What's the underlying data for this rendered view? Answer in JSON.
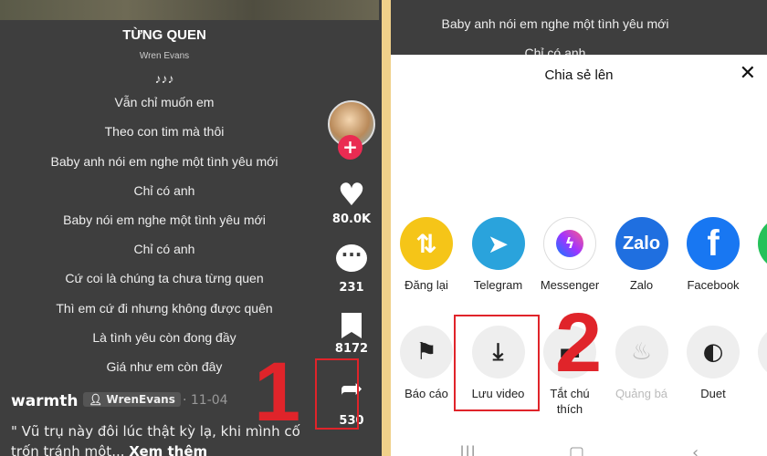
{
  "left": {
    "song_title": "TỪNG QUEN",
    "artist": "Wren Evans",
    "notes": "♪♪♪",
    "lyrics": [
      "Vẫn chỉ muốn em",
      "Theo con tim mà thôi",
      "Baby anh nói em nghe một tình yêu mới",
      "Chỉ có anh",
      "Baby nói em nghe một tình yêu mới",
      "Chỉ có anh",
      "Cứ coi là chúng ta chưa từng quen",
      "Thì em cứ đi nhưng không được quên",
      "Là tình yêu còn đong đầy",
      "Giá như em còn đây"
    ],
    "likes": "80.0K",
    "comments": "231",
    "saves": "8172",
    "shares": "530",
    "username": "warmth",
    "tag": "WrenEvans",
    "date": "· 11-04",
    "description": "\" Vũ trụ này đôi lúc thật kỳ lạ, khi mình cố trốn tránh một...",
    "see_more": "Xem thêm",
    "step": "1"
  },
  "right": {
    "bg_lyrics": [
      "Baby anh nói em nghe một tình yêu mới",
      "Chỉ có anh"
    ],
    "sheet_title": "Chia sẻ lên",
    "close": "✕",
    "share_row": [
      {
        "label": "Đăng lại",
        "icon": "repost-icon",
        "color": "#f5c518"
      },
      {
        "label": "Telegram",
        "icon": "telegram-icon",
        "color": "#2aa3dc"
      },
      {
        "label": "Messenger",
        "icon": "messenger-icon",
        "color": "#ffffff"
      },
      {
        "label": "Zalo",
        "icon": "zalo-icon",
        "color": "#1f6fe0",
        "text": "Zalo"
      },
      {
        "label": "Facebook",
        "icon": "facebook-icon",
        "color": "#1877f2",
        "text": "f"
      }
    ],
    "action_row": [
      {
        "label": "Báo cáo",
        "icon": "flag-icon"
      },
      {
        "label": "Lưu video",
        "icon": "download-icon"
      },
      {
        "label": "Tắt chú thích",
        "icon": "caption-icon"
      },
      {
        "label": "Quảng bá",
        "icon": "flame-icon",
        "disabled": true
      },
      {
        "label": "Duet",
        "icon": "duet-icon"
      }
    ],
    "step": "2"
  }
}
